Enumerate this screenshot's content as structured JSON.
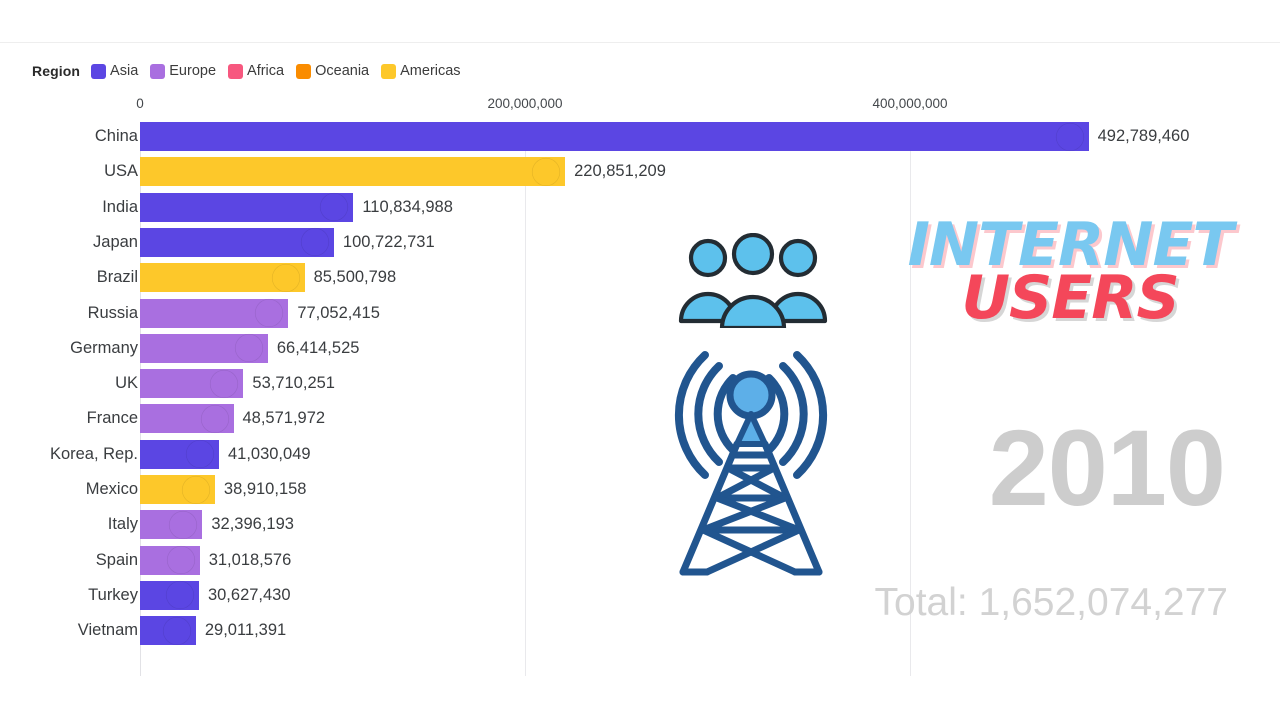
{
  "legend": {
    "title": "Region",
    "items": [
      {
        "label": "Asia",
        "color": "#5b46e3"
      },
      {
        "label": "Europe",
        "color": "#a96fe0"
      },
      {
        "label": "Africa",
        "color": "#f7587f"
      },
      {
        "label": "Oceania",
        "color": "#fa8c00"
      },
      {
        "label": "Americas",
        "color": "#fdc82a"
      }
    ]
  },
  "overlay": {
    "title_line1": "INTERNET",
    "title_line2": "USERS",
    "year": "2010",
    "total": "Total: 1,652,074,277",
    "people_icon": "people-group-icon",
    "tower_icon": "radio-tower-icon"
  },
  "chart_data": {
    "type": "bar",
    "orientation": "horizontal",
    "title": "INTERNET USERS",
    "xlabel": "",
    "ylabel": "",
    "xlim": [
      0,
      520000000
    ],
    "grid": true,
    "legend_position": "top-left",
    "axis_ticks": [
      "0",
      "200,000,000",
      "400,000,000"
    ],
    "axis_tick_values": [
      0,
      200000000,
      400000000
    ],
    "year": 2010,
    "total": 1652074277,
    "categories": [
      "China",
      "USA",
      "India",
      "Japan",
      "Brazil",
      "Russia",
      "Germany",
      "UK",
      "France",
      "Korea, Rep.",
      "Mexico",
      "Italy",
      "Spain",
      "Turkey",
      "Vietnam"
    ],
    "values": [
      492789460,
      220851209,
      110834988,
      100722731,
      85500798,
      77052415,
      66414525,
      53710251,
      48571972,
      41030049,
      38910158,
      32396193,
      31018576,
      30627430,
      29011391
    ],
    "bars": [
      {
        "label": "China",
        "value": 492789460,
        "value_text": "492,789,460",
        "region": "Asia",
        "color": "#5b46e3",
        "flag": "cn"
      },
      {
        "label": "USA",
        "value": 220851209,
        "value_text": "220,851,209",
        "region": "Americas",
        "color": "#fdc82a",
        "flag": "us"
      },
      {
        "label": "India",
        "value": 110834988,
        "value_text": "110,834,988",
        "region": "Asia",
        "color": "#5b46e3",
        "flag": "in"
      },
      {
        "label": "Japan",
        "value": 100722731,
        "value_text": "100,722,731",
        "region": "Asia",
        "color": "#5b46e3",
        "flag": "jp"
      },
      {
        "label": "Brazil",
        "value": 85500798,
        "value_text": "85,500,798",
        "region": "Americas",
        "color": "#fdc82a",
        "flag": "br"
      },
      {
        "label": "Russia",
        "value": 77052415,
        "value_text": "77,052,415",
        "region": "Europe",
        "color": "#a96fe0",
        "flag": "ru"
      },
      {
        "label": "Germany",
        "value": 66414525,
        "value_text": "66,414,525",
        "region": "Europe",
        "color": "#a96fe0",
        "flag": "de"
      },
      {
        "label": "UK",
        "value": 53710251,
        "value_text": "53,710,251",
        "region": "Europe",
        "color": "#a96fe0",
        "flag": "gb"
      },
      {
        "label": "France",
        "value": 48571972,
        "value_text": "48,571,972",
        "region": "Europe",
        "color": "#a96fe0",
        "flag": "fr"
      },
      {
        "label": "Korea, Rep.",
        "value": 41030049,
        "value_text": "41,030,049",
        "region": "Asia",
        "color": "#5b46e3",
        "flag": "kr"
      },
      {
        "label": "Mexico",
        "value": 38910158,
        "value_text": "38,910,158",
        "region": "Americas",
        "color": "#fdc82a",
        "flag": "mx"
      },
      {
        "label": "Italy",
        "value": 32396193,
        "value_text": "32,396,193",
        "region": "Europe",
        "color": "#a96fe0",
        "flag": "it"
      },
      {
        "label": "Spain",
        "value": 31018576,
        "value_text": "31,018,576",
        "region": "Europe",
        "color": "#a96fe0",
        "flag": "es"
      },
      {
        "label": "Turkey",
        "value": 30627430,
        "value_text": "30,627,430",
        "region": "Asia",
        "color": "#5b46e3",
        "flag": "tr"
      },
      {
        "label": "Vietnam",
        "value": 29011391,
        "value_text": "29,011,391",
        "region": "Asia",
        "color": "#5b46e3",
        "flag": "vn"
      }
    ]
  }
}
